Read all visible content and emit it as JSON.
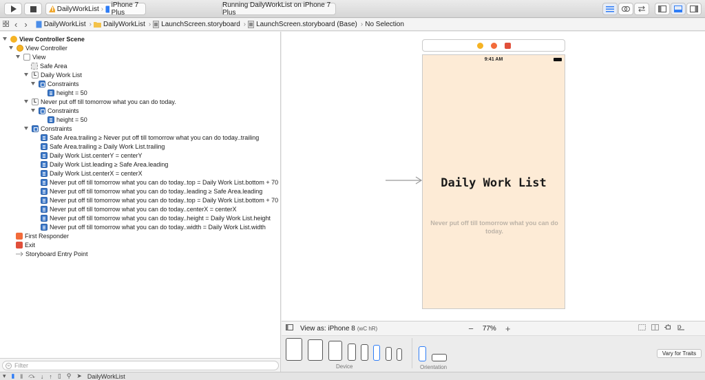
{
  "toolbar": {
    "scheme_project": "DailyWorkList",
    "scheme_device": "iPhone 7 Plus",
    "status": "Running DailyWorkList on iPhone 7 Plus"
  },
  "jumpbar": {
    "crumbs": [
      "DailyWorkList",
      "DailyWorkList",
      "LaunchScreen.storyboard",
      "LaunchScreen.storyboard (Base)",
      "No Selection"
    ]
  },
  "outline": {
    "items": [
      {
        "label": "View Controller Scene",
        "bold": true
      },
      {
        "label": "View Controller"
      },
      {
        "label": "View"
      },
      {
        "label": "Safe Area"
      },
      {
        "label": "Daily Work List"
      },
      {
        "label": "Constraints"
      },
      {
        "label": "height = 50"
      },
      {
        "label": "Never put off till tomorrow what you can do today."
      },
      {
        "label": "Constraints"
      },
      {
        "label": "height = 50"
      },
      {
        "label": "Constraints"
      },
      {
        "label": "Safe Area.trailing ≥ Never put off till tomorrow what you can do today..trailing"
      },
      {
        "label": "Safe Area.trailing ≥ Daily Work List.trailing"
      },
      {
        "label": "Daily Work List.centerY = centerY"
      },
      {
        "label": "Daily Work List.leading ≥ Safe Area.leading"
      },
      {
        "label": "Daily Work List.centerX = centerX"
      },
      {
        "label": "Never put off till tomorrow what you can do today..top = Daily Work List.bottom + 70"
      },
      {
        "label": "Never put off till tomorrow what you can do today..leading ≥ Safe Area.leading"
      },
      {
        "label": "Never put off till tomorrow what you can do today..top = Daily Work List.bottom + 70"
      },
      {
        "label": "Never put off till tomorrow what you can do today..centerX = centerX"
      },
      {
        "label": "Never put off till tomorrow what you can do today..height = Daily Work List.height"
      },
      {
        "label": "Never put off till tomorrow what you can do today..width = Daily Work List.width"
      },
      {
        "label": "First Responder"
      },
      {
        "label": "Exit"
      },
      {
        "label": "Storyboard Entry Point"
      }
    ]
  },
  "filter": {
    "placeholder": "Filter"
  },
  "debugbar": {
    "target": "DailyWorkList"
  },
  "canvas": {
    "time": "9:41 AM",
    "title": "Daily Work List",
    "subtitle": "Never put off till tomorrow what you can do today."
  },
  "canvasbar": {
    "view_as": "View as: iPhone 8",
    "traits": "(wC hR)",
    "zoom": "77%"
  },
  "devicebar": {
    "device_label": "Device",
    "orientation_label": "Orientation",
    "vary_button": "Vary for Traits"
  },
  "colors": {
    "accent": "#2d7cf6",
    "device_bg": "#fdebd6",
    "subtitle": "#bdb3a7"
  }
}
